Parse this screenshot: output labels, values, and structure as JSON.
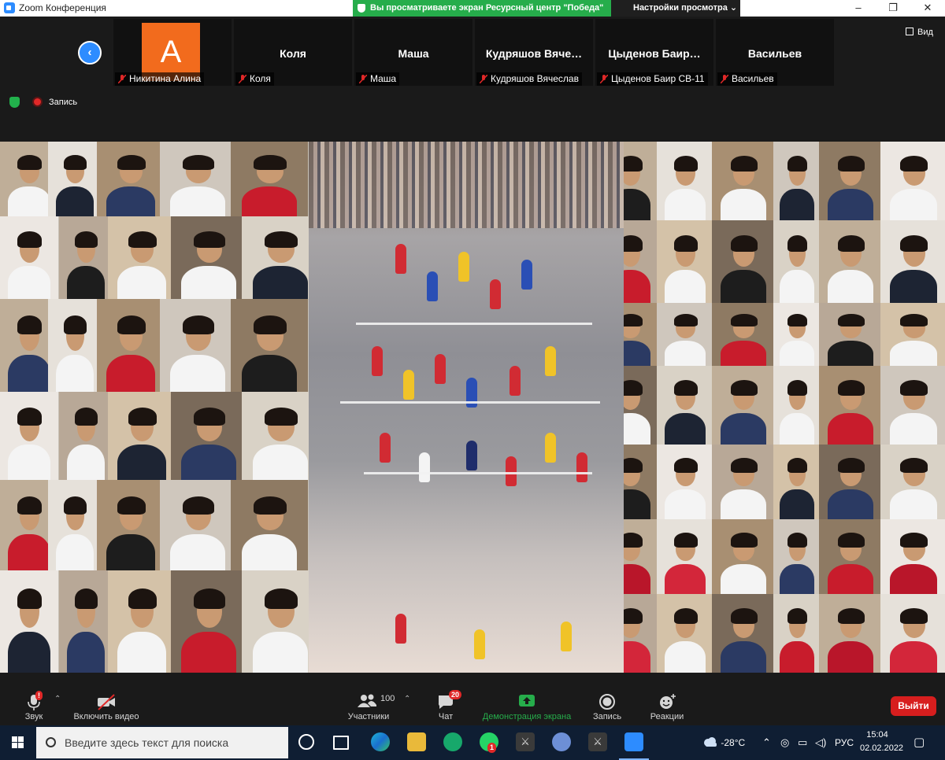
{
  "window": {
    "title": "Zoom Конференция",
    "minimize": "–",
    "maximize": "❐",
    "close": "✕"
  },
  "share_banner": {
    "text": "Вы просматриваете экран Ресурсный центр \"Победа\"",
    "view_options": "Настройки просмотра ⌄"
  },
  "view_button": "Вид",
  "participants": [
    {
      "display": "",
      "avatar_letter": "A",
      "label": "Никитина Алина",
      "muted": true
    },
    {
      "display": "Коля",
      "label": "Коля",
      "muted": true
    },
    {
      "display": "Маша",
      "label": "Маша",
      "muted": true
    },
    {
      "display": "Кудряшов Вяче…",
      "label": "Кудряшов Вячеслав",
      "muted": true
    },
    {
      "display": "Цыденов Баир…",
      "label": "Цыденов Баир СВ-11",
      "muted": true
    },
    {
      "display": "Васильев",
      "label": "Васильев",
      "muted": true
    }
  ],
  "status": {
    "recording": "Запись"
  },
  "toolbar": {
    "audio": "Звук",
    "audio_badge": "!",
    "video": "Включить видео",
    "participants": "Участники",
    "participants_count": "100",
    "chat": "Чат",
    "chat_badge": "20",
    "share": "Демонстрация экрана",
    "record": "Запись",
    "reactions": "Реакции",
    "leave": "Выйти"
  },
  "taskbar": {
    "search_placeholder": "Введите здесь текст для поиска",
    "whatsapp_badge": "1",
    "temperature": "-28°C",
    "language": "РУС",
    "time": "15:04",
    "date": "02.02.2022"
  },
  "colors": {
    "accent": "#2d8cff",
    "share_green": "#26ad4b",
    "leave_red": "#d71e1e",
    "avatar_orange": "#f26b1d"
  }
}
